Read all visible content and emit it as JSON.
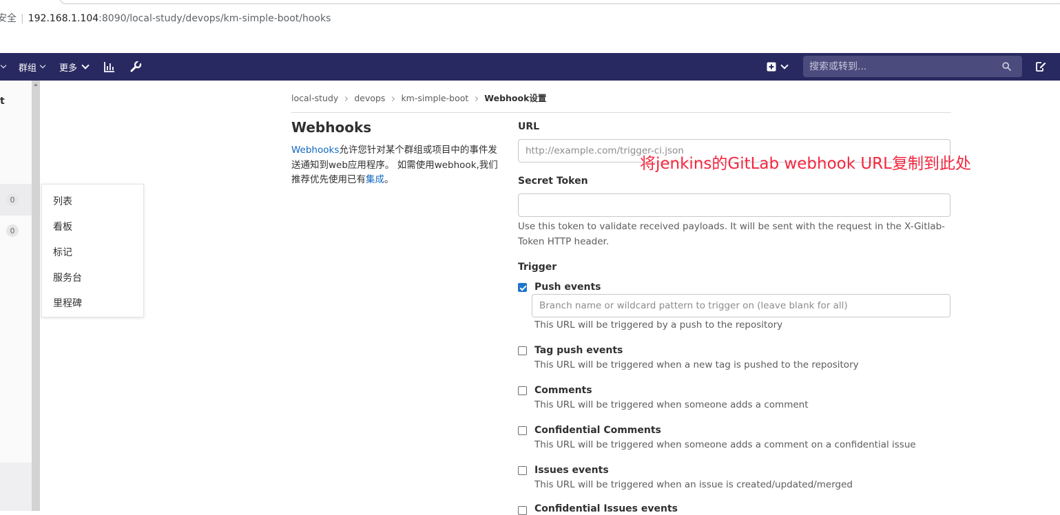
{
  "browser": {
    "insecure_label": "安全",
    "url_host": "192.168.1.104",
    "url_path": ":8090/local-study/devops/km-simple-boot/hooks"
  },
  "topnav": {
    "groups_label": "群组",
    "more_label": "更多",
    "search_placeholder": "搜索或转到..."
  },
  "sidebar": {
    "title_fragment": "t",
    "badges": [
      "0",
      "0"
    ]
  },
  "flyout": {
    "items": [
      "列表",
      "看板",
      "标记",
      "服务台",
      "里程碑"
    ]
  },
  "breadcrumb": {
    "items": [
      "local-study",
      "devops",
      "km-simple-boot"
    ],
    "current": "Webhook设置"
  },
  "intro": {
    "title": "Webhooks",
    "link_text": "Webhooks",
    "text_1": "允许您针对某个群组或项目中的事件发送通知到web应用程序。 如需使用webhook,我们推荐优先使用已有",
    "link_integrations": "集成",
    "text_2": "。"
  },
  "form": {
    "url_label": "URL",
    "url_placeholder": "http://example.com/trigger-ci.json",
    "annotation": "将jenkins的GitLab webhook URL复制到此处",
    "secret_label": "Secret Token",
    "secret_help": "Use this token to validate received payloads. It will be sent with the request in the X-Gitlab-Token HTTP header.",
    "trigger_label": "Trigger",
    "branch_placeholder": "Branch name or wildcard pattern to trigger on (leave blank for all)"
  },
  "events": [
    {
      "title": "Push events",
      "desc": "This URL will be triggered by a push to the repository",
      "checked": true
    },
    {
      "title": "Tag push events",
      "desc": "This URL will be triggered when a new tag is pushed to the repository",
      "checked": false
    },
    {
      "title": "Comments",
      "desc": "This URL will be triggered when someone adds a comment",
      "checked": false
    },
    {
      "title": "Confidential Comments",
      "desc": "This URL will be triggered when someone adds a comment on a confidential issue",
      "checked": false
    },
    {
      "title": "Issues events",
      "desc": "This URL will be triggered when an issue is created/updated/merged",
      "checked": false
    },
    {
      "title": "Confidential Issues events",
      "desc": "",
      "checked": false
    }
  ],
  "colors": {
    "nav_bg": "#292961",
    "link": "#1068bf",
    "annotation": "#f4263f",
    "checkbox_on": "#1f75cb"
  },
  "icons": [
    "chevron-down-icon",
    "chart-icon",
    "wrench-icon",
    "plus-square-icon",
    "search-icon",
    "edit-icon"
  ]
}
